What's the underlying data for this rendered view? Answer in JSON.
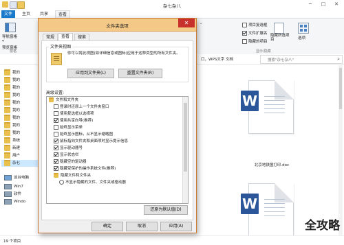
{
  "window": {
    "title": "杂七杂八",
    "minimize": "─",
    "maximize": "□",
    "close": "✕"
  },
  "ribbon": {
    "tabs": [
      "文件",
      "主页",
      "共享",
      "查看"
    ],
    "nav_pane_label": "导航窗格",
    "preview_pane_label": "预览窗格",
    "item_checkboxes_label": "项目复选框",
    "file_extensions_label": "文件扩展名",
    "hidden_items_label": "隐藏的项目",
    "hide_selected_label": "隐藏所选项目",
    "options_label": "选项",
    "panes_group": "窗格",
    "show_hide_group": "显示/隐藏"
  },
  "address": {
    "partial": "口，WPS文字 文档",
    "search_placeholder": "搜索\"杂七杂八\""
  },
  "nav": {
    "items": [
      {
        "label": "我的",
        "type": "folder"
      },
      {
        "label": "我的",
        "type": "folder"
      },
      {
        "label": "我的",
        "type": "folder"
      },
      {
        "label": "我的",
        "type": "folder"
      },
      {
        "label": "我的",
        "type": "folder"
      },
      {
        "label": "我的",
        "type": "folder"
      },
      {
        "label": "我的",
        "type": "folder"
      },
      {
        "label": "我的",
        "type": "folder"
      },
      {
        "label": "我的",
        "type": "folder"
      },
      {
        "label": "系统",
        "type": "folder"
      },
      {
        "label": "新建",
        "type": "folder"
      },
      {
        "label": "用户",
        "type": "folder"
      },
      {
        "label": "杂七",
        "type": "folder"
      },
      {
        "label": "这台电脑",
        "type": "folder"
      },
      {
        "label": "Win7",
        "type": "drive"
      },
      {
        "label": "软件",
        "type": "drive"
      },
      {
        "label": "Windo",
        "type": "drive"
      }
    ]
  },
  "files": [
    {
      "name": "北京地铁图打印.doc",
      "icon": "word-doc-icon"
    },
    {
      "name": "",
      "icon": "word-doc-icon"
    }
  ],
  "status": {
    "count": "19 个项目"
  },
  "dialog": {
    "title": "文件夹选项",
    "close": "✕",
    "tabs": [
      "常规",
      "查看",
      "搜索"
    ],
    "active_tab": "查看",
    "folder_views_title": "文件夹视图",
    "folder_views_desc": "你可以将此视图(如详细信息或图标)应用于这种类型的所有文件夹。",
    "apply_to_folders": "应用到文件夹(L)",
    "reset_folders": "重置文件夹(R)",
    "advanced_title": "高级设置:",
    "advanced_items": [
      {
        "label": "文件和文件夹",
        "kind": "folder",
        "checked": false
      },
      {
        "label": "登录时还原上一个文件夹窗口",
        "kind": "check",
        "checked": false
      },
      {
        "label": "使用复选框以选择项",
        "kind": "check",
        "checked": false
      },
      {
        "label": "使用共享向导(推荐)",
        "kind": "check",
        "checked": true
      },
      {
        "label": "始终显示菜单",
        "kind": "check",
        "checked": false
      },
      {
        "label": "始终显示图标，从不显示缩略图",
        "kind": "check",
        "checked": false
      },
      {
        "label": "鼠标指向文件夹和桌面项时显示提示信息",
        "kind": "check",
        "checked": true
      },
      {
        "label": "显示驱动器号",
        "kind": "check",
        "checked": true
      },
      {
        "label": "显示状态栏",
        "kind": "check",
        "checked": true
      },
      {
        "label": "隐藏空的驱动器",
        "kind": "check",
        "checked": true
      },
      {
        "label": "隐藏受保护的操作系统文件(推荐)",
        "kind": "check",
        "checked": true
      },
      {
        "label": "隐藏文件和文件夹",
        "kind": "folder",
        "checked": false
      },
      {
        "label": "不显示隐藏的文件、文件夹或驱动器",
        "kind": "radio",
        "checked": true
      }
    ],
    "restore_defaults": "还原为默认值(D)",
    "ok": "确定",
    "cancel": "取消",
    "apply": "应用(A)"
  },
  "watermark": "全攻略"
}
